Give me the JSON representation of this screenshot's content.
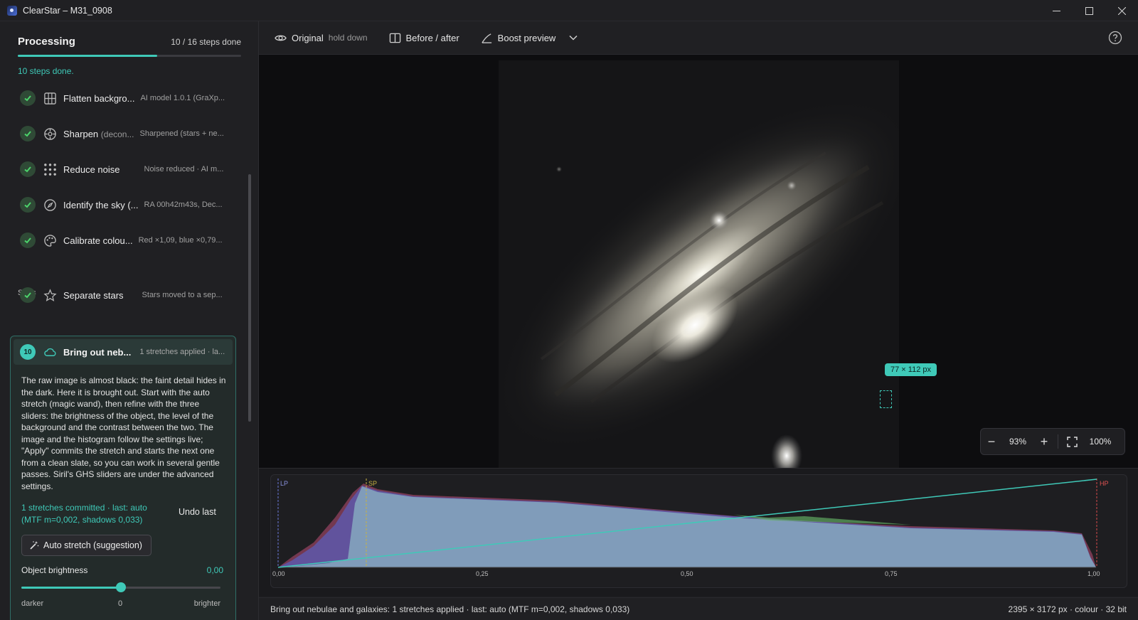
{
  "window": {
    "title": "ClearStar – M31_0908"
  },
  "sidebar": {
    "title": "Processing",
    "step_count": "10 / 16 steps done",
    "progress_fraction": 0.625,
    "steps_done_text": "10 steps done.",
    "steps": [
      {
        "name": "Flatten backgro...",
        "desc": "AI model 1.0.1 (GraXp...",
        "icon": "grid-icon"
      },
      {
        "name": "Sharpen",
        "name_muted": "(decon...",
        "desc": "Sharpened (stars + ne...",
        "icon": "crosshair-icon"
      },
      {
        "name": "Reduce noise",
        "desc": "Noise reduced · AI m...",
        "icon": "dots-grid-icon"
      },
      {
        "name": "Identify the sky (...",
        "desc": "RA 00h42m43s, Dec...",
        "icon": "compass-icon"
      },
      {
        "name": "Calibrate colou...",
        "desc": "Red ×1,09, blue ×0,79...",
        "icon": "palette-icon"
      }
    ],
    "stars_section": "Stars",
    "stars_step": {
      "name": "Separate stars",
      "desc": "Stars moved to a sep...",
      "icon": "star-icon"
    },
    "active_step": {
      "number": "10",
      "name": "Bring out neb...",
      "desc": "1 stretches applied · la...",
      "icon": "cloud-icon",
      "explanation": "The raw image is almost black: the faint detail hides in the dark. Here it is brought out. Start with the auto stretch (magic wand), then refine with the three sliders: the brightness of the object, the level of the background and the contrast between the two. The image and the histogram follow the settings live; \"Apply\" commits the stretch and starts the next one from a clean slate, so you can work in several gentle passes. Siril's GHS sliders are under the advanced settings.",
      "committed": "1 stretches committed · last: auto (MTF m=0,002, shadows 0,033)",
      "undo_label": "Undo last",
      "auto_button": "Auto stretch (suggestion)",
      "slider": {
        "label": "Object brightness",
        "value": "0,00",
        "min_label": "darker",
        "mid_label": "0",
        "max_label": "brighter"
      }
    }
  },
  "toolbar": {
    "original_label": "Original",
    "original_hint": "hold down",
    "before_after_label": "Before / after",
    "boost_label": "Boost preview"
  },
  "canvas": {
    "selection_label": "77 × 112 px",
    "zoom_value": "93%",
    "zoom_reset": "100%"
  },
  "histogram": {
    "ticks": [
      "0,00",
      "0,25",
      "0,50",
      "0,75",
      "1,00"
    ],
    "markers": {
      "lp": "LP",
      "sp": "SP",
      "hp": "HP"
    }
  },
  "statusbar": {
    "left": "Bring out nebulae and galaxies: 1 stretches applied · last: auto (MTF m=0,002, shadows 0,033)",
    "right": "2395 × 3172 px · colour · 32 bit"
  }
}
